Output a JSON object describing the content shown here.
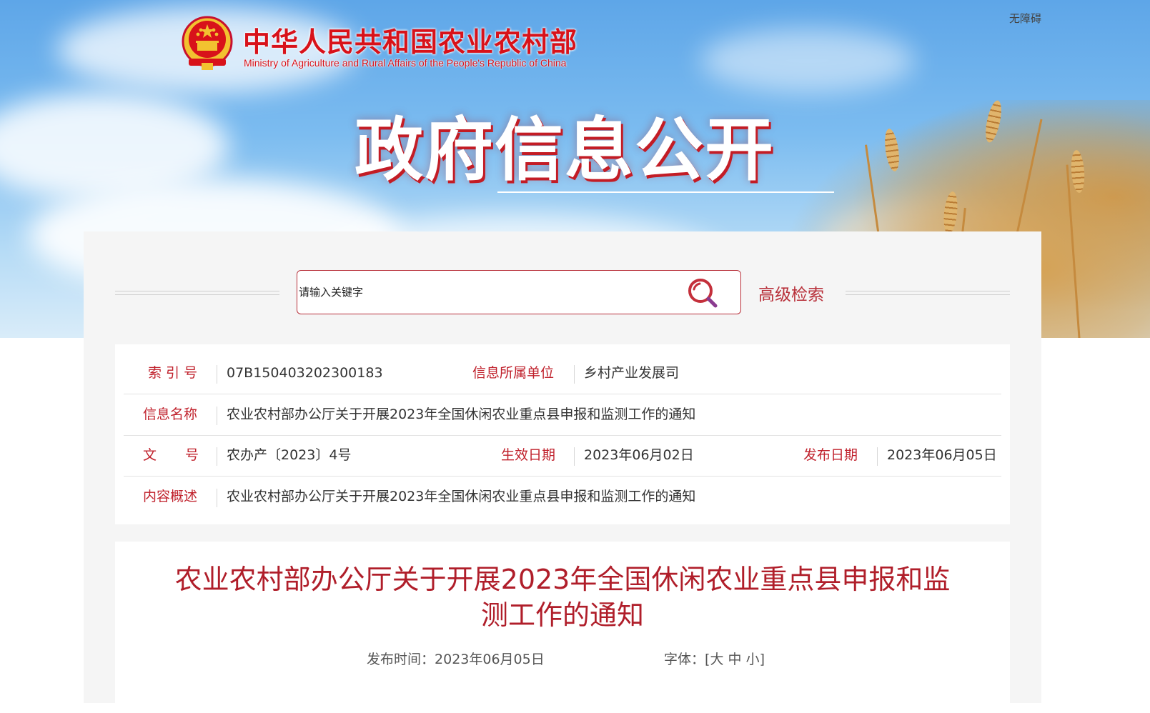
{
  "header": {
    "ministry_cn": "中华人民共和国农业农村部",
    "ministry_en": "Ministry of Agriculture and Rural Affairs of the People's Republic of China",
    "accessibility": "无障碍",
    "page_title": "政府信息公开"
  },
  "search": {
    "placeholder": "请输入关键字",
    "advanced_label": "高级检索"
  },
  "info": {
    "index_label": "索 引 号",
    "index_value": "07B150403202300183",
    "unit_label": "信息所属单位",
    "unit_value": "乡村产业发展司",
    "name_label": "信息名称",
    "name_value": "农业农村部办公厅关于开展2023年全国休闲农业重点县申报和监测工作的通知",
    "doc_label_1": "文",
    "doc_label_2": "号",
    "doc_value": "农办产〔2023〕4号",
    "effective_label": "生效日期",
    "effective_value": "2023年06月02日",
    "publish_label": "发布日期",
    "publish_value": "2023年06月05日",
    "summary_label": "内容概述",
    "summary_value": "农业农村部办公厅关于开展2023年全国休闲农业重点县申报和监测工作的通知"
  },
  "article": {
    "title": "农业农村部办公厅关于开展2023年全国休闲农业重点县申报和监测工作的通知",
    "date_label": "发布时间：",
    "date_value": "2023年06月05日",
    "font_label": "字体：",
    "font_open": "[",
    "font_large": "大",
    "font_medium": "中",
    "font_small": "小",
    "font_close": "]"
  },
  "colors": {
    "brand_red": "#d8121a",
    "label_red": "#c0212c",
    "title_red": "#b01e2a"
  },
  "icons": {
    "emblem": "national-emblem-icon",
    "search": "search-icon"
  }
}
